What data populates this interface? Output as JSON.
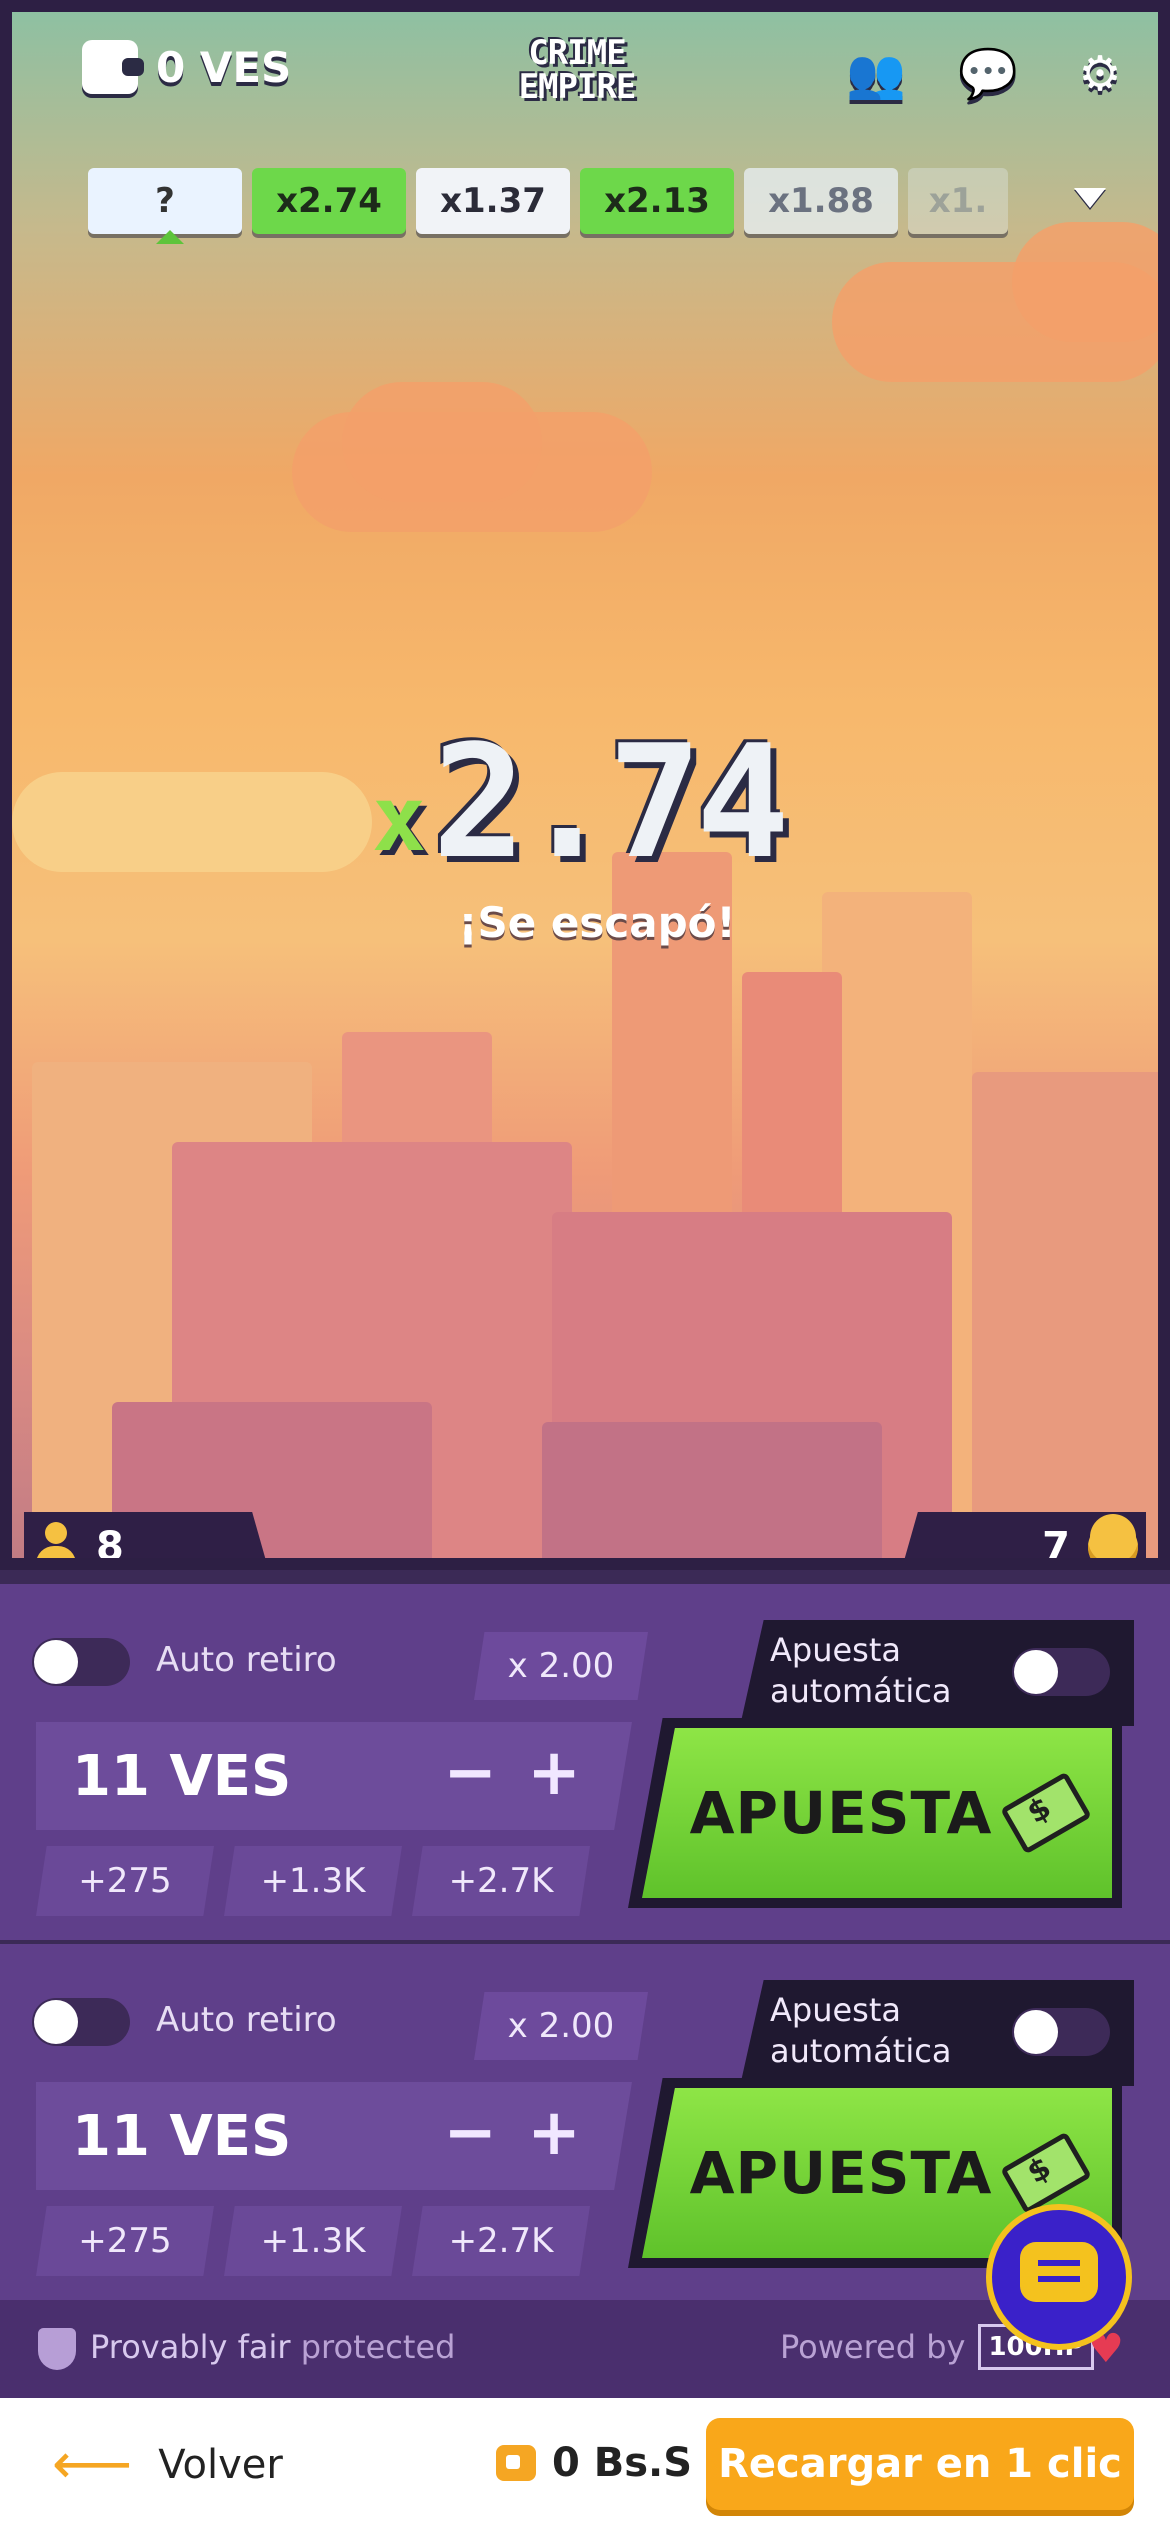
{
  "header": {
    "balance": "0 VES",
    "logo_line1": "CRIME",
    "logo_line2": "EMPIRE",
    "icons": [
      "users-icon",
      "chat-icon",
      "settings-icon"
    ]
  },
  "history": [
    "?",
    "x2.74",
    "x1.37",
    "x2.13",
    "x1.88",
    "x1."
  ],
  "round": {
    "multiplier_prefix": "x",
    "multiplier": "2.74",
    "status": "¡Se escapó!"
  },
  "stats": {
    "players": "8",
    "bets": "7"
  },
  "panels": [
    {
      "auto_cashout_label": "Auto retiro",
      "auto_cashout_value": "x 2.00",
      "auto_bet_label_1": "Apuesta",
      "auto_bet_label_2": "automática",
      "amount": "11 VES",
      "minus": "−",
      "plus": "+",
      "quick": [
        "+275",
        "+1.3K",
        "+2.7K"
      ],
      "bet_label": "APUESTA"
    },
    {
      "auto_cashout_label": "Auto retiro",
      "auto_cashout_value": "x 2.00",
      "auto_bet_label_1": "Apuesta",
      "auto_bet_label_2": "automática",
      "amount": "11 VES",
      "minus": "−",
      "plus": "+",
      "quick": [
        "+275",
        "+1.3K",
        "+2.7K"
      ],
      "bet_label": "APUESTA"
    }
  ],
  "fair": {
    "provably": "Provably fair",
    "protected": "protected",
    "powered_by": "Powered by",
    "brand": "100HP"
  },
  "footer": {
    "back": "Volver",
    "balance": "0 Bs.S",
    "recharge": "Recargar en 1 clic"
  },
  "colors": {
    "accent_green": "#6dd84a",
    "panel_purple": "#5f3f8a",
    "recharge_orange": "#f9a71a"
  }
}
